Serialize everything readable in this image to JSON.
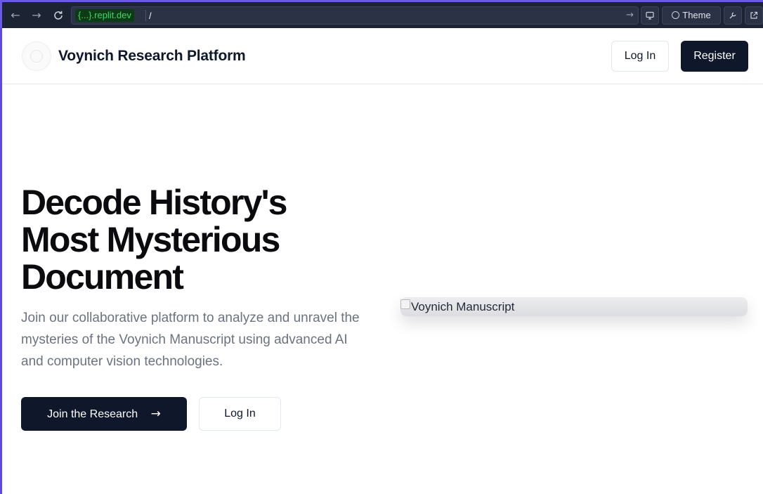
{
  "browser": {
    "url_host": "{...}.replit.dev",
    "url_path": "/",
    "theme_label": "Theme"
  },
  "header": {
    "brand": "Voynich Research Platform",
    "login_label": "Log In",
    "register_label": "Register"
  },
  "hero": {
    "headline_line1": "Decode History's",
    "headline_line2": "Most Mysterious",
    "headline_line3": "Document",
    "description": "Join our collaborative platform to analyze and unravel the mysteries of the Voynich Manuscript using advanced AI and computer vision technologies.",
    "join_label": "Join the Research",
    "login_label": "Log In",
    "image_alt": "Voynich Manuscript"
  },
  "icons": {
    "back": "arrow-left-icon",
    "forward": "arrow-right-icon",
    "reload": "reload-icon",
    "go": "arrow-right-icon",
    "devices": "monitor-icon",
    "theme": "palette-icon",
    "tools": "wrench-icon",
    "open": "external-link-icon",
    "join_arrow": "arrow-right-icon"
  },
  "colors": {
    "primary": "#0f172a",
    "url_highlight": "#3fd66a",
    "muted_text": "#6b7280"
  }
}
